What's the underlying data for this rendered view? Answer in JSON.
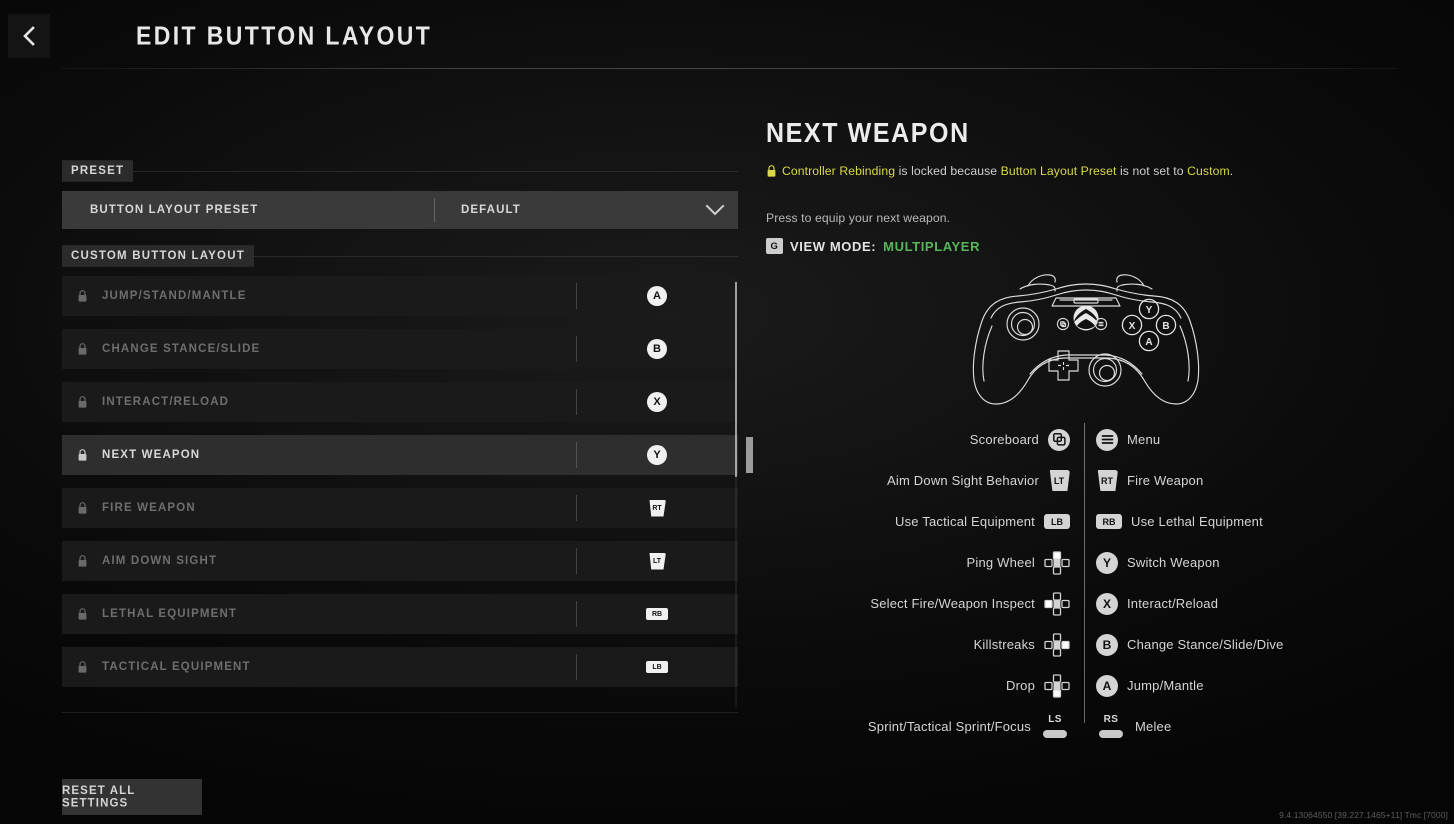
{
  "header": {
    "title": "EDIT BUTTON LAYOUT",
    "back_icon": "chevron-left-icon"
  },
  "left_panel": {
    "preset_section": {
      "heading": "PRESET",
      "row": {
        "label": "BUTTON LAYOUT PRESET",
        "value": "DEFAULT",
        "chevron_icon": "chevron-down-icon"
      }
    },
    "custom_section": {
      "heading": "CUSTOM BUTTON LAYOUT"
    },
    "bindings": [
      {
        "name": "JUMP/STAND/MANTLE",
        "locked": true,
        "selected": false,
        "badge": "A",
        "badge_type": "face"
      },
      {
        "name": "CHANGE STANCE/SLIDE",
        "locked": true,
        "selected": false,
        "badge": "B",
        "badge_type": "face"
      },
      {
        "name": "INTERACT/RELOAD",
        "locked": true,
        "selected": false,
        "badge": "X",
        "badge_type": "face"
      },
      {
        "name": "NEXT WEAPON",
        "locked": true,
        "selected": true,
        "badge": "Y",
        "badge_type": "face"
      },
      {
        "name": "FIRE WEAPON",
        "locked": true,
        "selected": false,
        "badge": "RT",
        "badge_type": "trigger"
      },
      {
        "name": "AIM DOWN SIGHT",
        "locked": true,
        "selected": false,
        "badge": "LT",
        "badge_type": "trigger"
      },
      {
        "name": "LETHAL EQUIPMENT",
        "locked": true,
        "selected": false,
        "badge": "RB",
        "badge_type": "bumper"
      },
      {
        "name": "TACTICAL EQUIPMENT",
        "locked": true,
        "selected": false,
        "badge": "LB",
        "badge_type": "bumper"
      }
    ],
    "reset_button": "RESET ALL SETTINGS"
  },
  "right_panel": {
    "title": "NEXT WEAPON",
    "lock_note": {
      "lock_icon": "lock-icon",
      "part1": "Controller Rebinding",
      "part2": " is locked because ",
      "part3": "Button Layout Preset",
      "part4": " is not set to ",
      "part5": "Custom",
      "part6": "."
    },
    "description": "Press to equip your next weapon.",
    "view_mode": {
      "key": "G",
      "label": "VIEW MODE:",
      "value": "MULTIPLAYER"
    },
    "controller_image": "xbox-controller-diagram",
    "legend": [
      {
        "left_label": "Scoreboard",
        "left_icon": "view-icon",
        "left_text": "",
        "right_label": "Menu",
        "right_icon": "menu-icon",
        "right_text": ""
      },
      {
        "left_label": "Aim Down Sight Behavior",
        "left_icon": "trigger-icon",
        "left_text": "LT",
        "right_label": "Fire Weapon",
        "right_icon": "trigger-icon",
        "right_text": "RT"
      },
      {
        "left_label": "Use Tactical Equipment",
        "left_icon": "bumper-icon",
        "left_text": "LB",
        "right_label": "Use Lethal Equipment",
        "right_icon": "bumper-icon",
        "right_text": "RB"
      },
      {
        "left_label": "Ping Wheel",
        "left_icon": "dpad-up-icon",
        "left_text": "",
        "right_label": "Switch Weapon",
        "right_icon": "face-icon",
        "right_text": "Y"
      },
      {
        "left_label": "Select Fire/Weapon Inspect",
        "left_icon": "dpad-left-icon",
        "left_text": "",
        "right_label": "Interact/Reload",
        "right_icon": "face-icon",
        "right_text": "X"
      },
      {
        "left_label": "Killstreaks",
        "left_icon": "dpad-right-icon",
        "left_text": "",
        "right_label": "Change Stance/Slide/Dive",
        "right_icon": "face-icon",
        "right_text": "B"
      },
      {
        "left_label": "Drop",
        "left_icon": "dpad-down-icon",
        "left_text": "",
        "right_label": "Jump/Mantle",
        "right_icon": "face-icon",
        "right_text": "A"
      },
      {
        "left_label": "Sprint/Tactical Sprint/Focus",
        "left_icon": "stick-icon",
        "left_text": "LS",
        "right_label": "Melee",
        "right_icon": "stick-icon",
        "right_text": "RS"
      }
    ]
  },
  "footer": {
    "build_version": "9.4.13064550 [39.227.1465+11] Tmc [7000]"
  },
  "colors": {
    "accent_yellow": "#d9d84a",
    "accent_green": "#58b65a",
    "selected_row": "#2e2e2e",
    "row": "#1a1a1a",
    "preset_row": "#3a3a3a"
  }
}
